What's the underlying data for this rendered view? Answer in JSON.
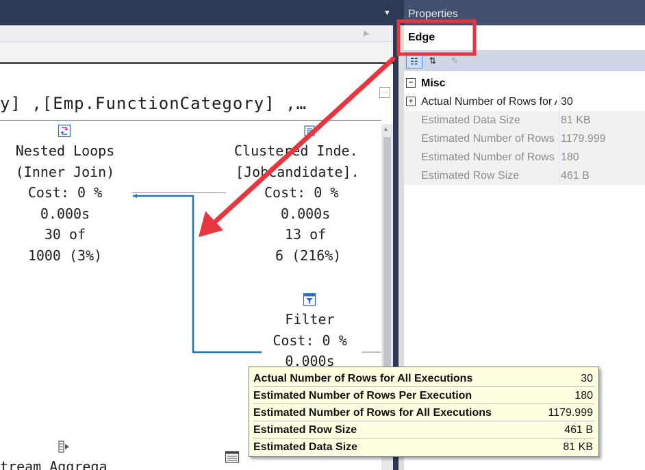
{
  "plan": {
    "statement": "y] ,[Emp.FunctionCategory] ,…",
    "nodes": {
      "nested_loops": [
        "Nested Loops",
        "(Inner Join)",
        "Cost: 0 %",
        "0.000s",
        "30 of",
        "1000 (3%)"
      ],
      "clustered_index": [
        "Clustered Inde.",
        "[JobCandidate].",
        "Cost: 0 %",
        "0.000s",
        "13 of",
        "6 (216%)"
      ],
      "filter": [
        "Filter",
        "Cost: 0 %",
        "0.000s"
      ],
      "stream_aggregate": [
        "tream Aggrega"
      ]
    }
  },
  "properties": {
    "title": "Properties",
    "object": "Edge",
    "category": "Misc",
    "rows": [
      {
        "name": "Actual Number of Rows for All Executions",
        "value": "30",
        "readonly": false,
        "expandable": true
      },
      {
        "name": "Estimated Data Size",
        "value": "81 KB",
        "readonly": true,
        "expandable": false
      },
      {
        "name": "Estimated Number of Rows Per Execution",
        "value": "1179.999",
        "readonly": true,
        "expandable": false
      },
      {
        "name": "Estimated Number of Rows for All Executions",
        "value": "180",
        "readonly": true,
        "expandable": false
      },
      {
        "name": "Estimated Row Size",
        "value": "461 B",
        "readonly": true,
        "expandable": false
      }
    ]
  },
  "tooltip": {
    "rows": [
      {
        "label": "Actual Number of Rows for All Executions",
        "value": "30"
      },
      {
        "label": "Estimated Number of Rows Per Execution",
        "value": "180"
      },
      {
        "label": "Estimated Number of Rows for All Executions",
        "value": "1179.999"
      },
      {
        "label": "Estimated Row Size",
        "value": "461 B"
      },
      {
        "label": "Estimated Data Size",
        "value": "81 KB"
      }
    ]
  },
  "icons": {
    "nested_loops": "nested-loops-icon",
    "clustered_index": "clustered-index-scan-icon",
    "filter": "filter-icon",
    "stream_aggregate": "stream-aggregate-icon",
    "compute_scalar": "compute-scalar-icon"
  },
  "colors": {
    "titlebar": "#2d3a56",
    "annotation_red": "#e8363e",
    "plan_edge_blue": "#1a73c7",
    "tooltip_bg": "#ffffe1"
  }
}
